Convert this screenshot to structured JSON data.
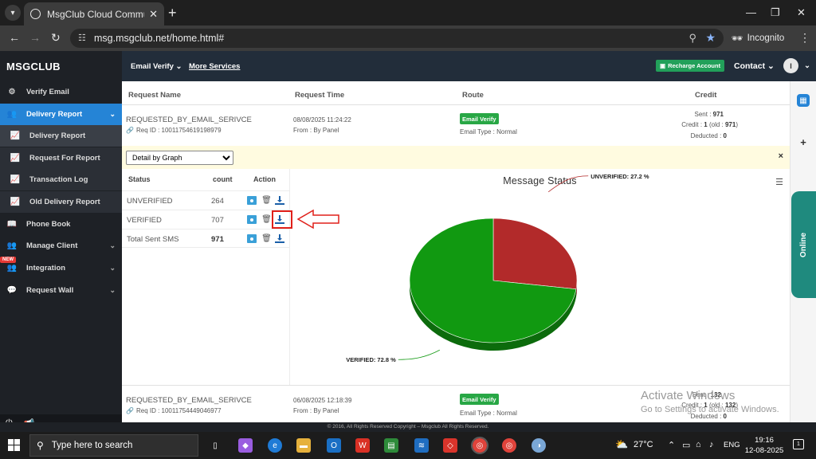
{
  "browser": {
    "tab_title": "MsgClub Cloud Communication",
    "url": "msg.msgclub.net/home.html#",
    "profile_label": "Incognito"
  },
  "sidebar": {
    "brand": "MSGCLUB",
    "items": [
      {
        "label": "Verify Email",
        "icon": "gear-icon"
      },
      {
        "label": "Delivery Report",
        "icon": "users-icon"
      },
      {
        "label": "Delivery Report",
        "icon": "chart-icon"
      },
      {
        "label": "Request For Report",
        "icon": "chart-icon"
      },
      {
        "label": "Transaction Log",
        "icon": "chart-icon"
      },
      {
        "label": "Old Delivery Report",
        "icon": "chart-icon"
      },
      {
        "label": "Phone Book",
        "icon": "book-icon"
      },
      {
        "label": "Manage Client",
        "icon": "users-icon"
      },
      {
        "label": "Integration",
        "icon": "users-icon"
      },
      {
        "label": "Request Wall",
        "icon": "chat-icon"
      }
    ],
    "new_badge": "NEW"
  },
  "topnav": {
    "email_verify": "Email Verify",
    "more_services": "More Services",
    "recharge": "Recharge Account",
    "contact": "Contact",
    "avatar_initial": "I"
  },
  "table": {
    "headers": {
      "name": "Request Name",
      "time": "Request Time",
      "route": "Route",
      "credit": "Credit"
    },
    "requests": [
      {
        "name": "REQUESTED_BY_EMAIL_SERIVCE",
        "req_id": "Req ID : 10011754619198979",
        "time": "08/08/2025 11:24:22",
        "from": "From : By Panel",
        "route": "Email Verify",
        "email_type": "Email Type : Normal",
        "sent_label": "Sent : ",
        "sent": "971",
        "credit_label": "Credit : ",
        "credit": "1",
        "credit_old_label": " (old : ",
        "credit_old": "971",
        "credit_close": ")",
        "deducted_label": "Deducted : ",
        "deducted": "0"
      },
      {
        "name": "REQUESTED_BY_EMAIL_SERIVCE",
        "req_id": "Req ID : 10011754449046977",
        "time": "06/08/2025 12:18:39",
        "from": "From : By Panel",
        "route": "Email Verify",
        "email_type": "Email Type : Normal",
        "sent_label": "Sent : ",
        "sent": "132",
        "credit_label": "Credit : ",
        "credit": "1",
        "credit_old_label": " (old : ",
        "credit_old": "132",
        "credit_close": ")",
        "deducted_label": "Deducted : ",
        "deducted": "0"
      }
    ]
  },
  "detail": {
    "select_value": "Detail by Graph",
    "close": "×"
  },
  "status_table": {
    "headers": {
      "status": "Status",
      "count": "count",
      "action": "Action"
    },
    "rows": [
      {
        "status": "UNVERIFIED",
        "count": "264"
      },
      {
        "status": "VERIFIED",
        "count": "707"
      },
      {
        "status": "Total Sent SMS",
        "count": "971"
      }
    ]
  },
  "chart_data": {
    "type": "pie",
    "title": "Message Status",
    "slices": [
      {
        "label": "UNVERIFIED",
        "value": 27.2,
        "color": "#b22a2a",
        "display": "UNVERIFIED: 27.2 %"
      },
      {
        "label": "VERIFIED",
        "value": 72.8,
        "color": "#119911",
        "display": "VERIFIED: 72.8 %"
      }
    ]
  },
  "watermark": {
    "line1": "Activate Windows",
    "line2": "Go to Settings to activate Windows."
  },
  "footer": {
    "copyright": "© 2016, All Rights Reserved Copyright – Msgclub All Rights Reserved."
  },
  "taskbar": {
    "search_placeholder": "Type here to search",
    "temperature": "27°C",
    "language": "ENG",
    "time": "19:16",
    "date": "12-08-2025"
  },
  "colors": {
    "accent": "#2584d6",
    "topnav": "#222d3a",
    "sidebar": "#1e2126",
    "success": "#28a745",
    "highlight": "#e0201a"
  }
}
